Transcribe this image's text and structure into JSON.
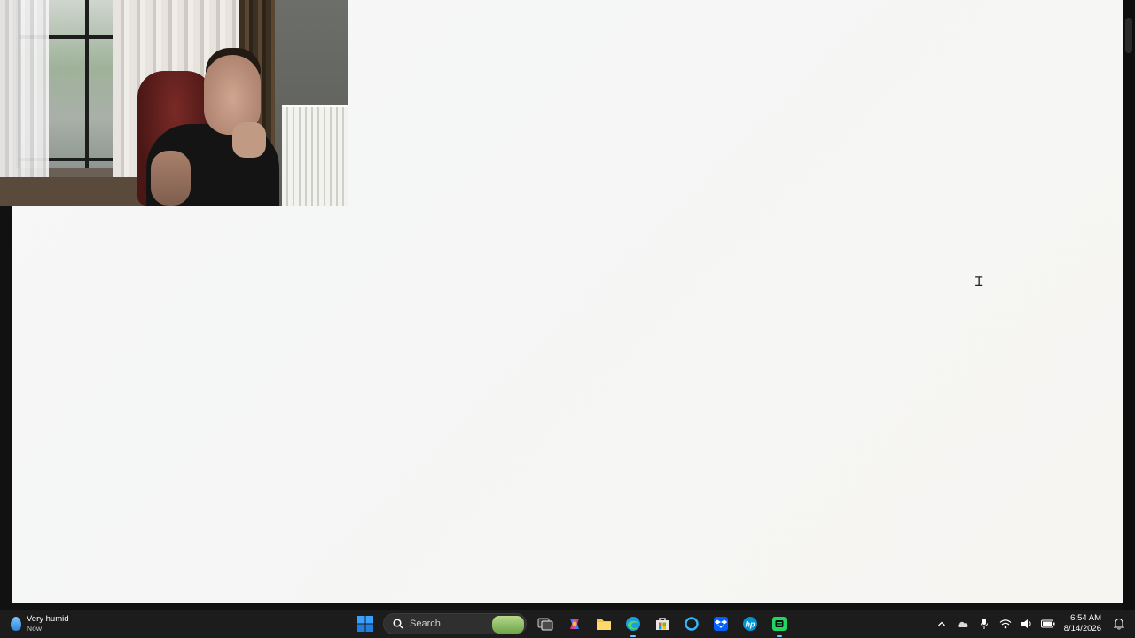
{
  "taskbar": {
    "weather": {
      "condition": "Very humid",
      "time": "Now"
    },
    "search": {
      "placeholder": "Search"
    },
    "pinned_apps": [
      "start-icon",
      "task-view-icon",
      "copilot-icon",
      "file-explorer-icon",
      "edge-icon",
      "microsoft-store-icon",
      "cortana-icon",
      "dropbox-icon",
      "hp-icon",
      "spotify-icon"
    ],
    "tray_icons": [
      "chevron-up-icon",
      "onedrive-icon",
      "microphone-icon",
      "wifi-icon",
      "volume-icon",
      "battery-icon"
    ],
    "clock": {
      "time": "6:54 AM",
      "date": "8/14/2026"
    },
    "notification_icon": "bell-icon"
  },
  "colors": {
    "taskbar_bg": "#1c1c1c",
    "accent": "#60cdff",
    "page_bg": "#f6f7f7"
  }
}
